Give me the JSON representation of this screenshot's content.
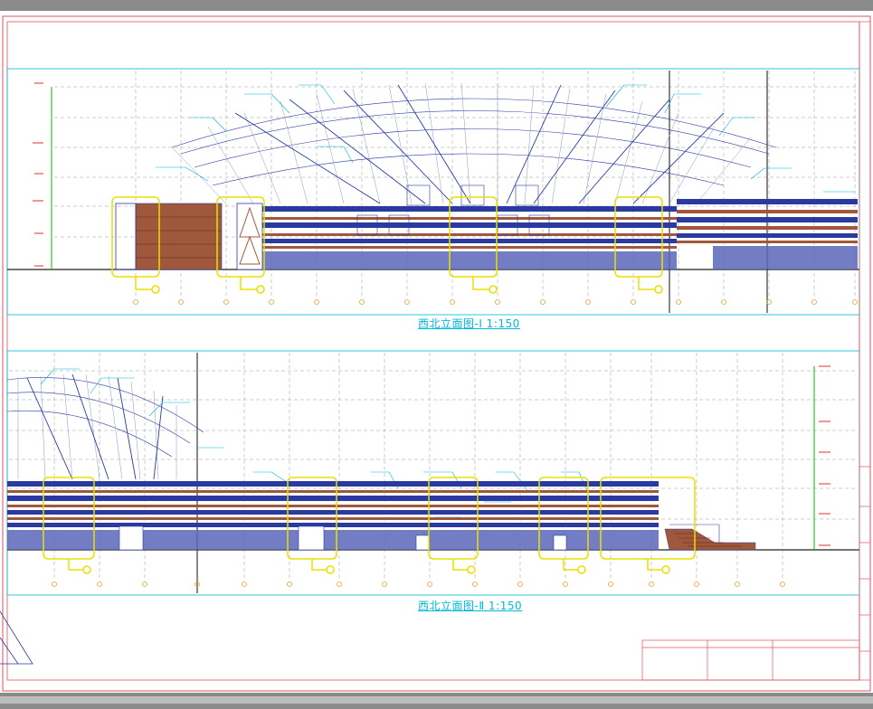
{
  "drawing": {
    "elevation_1_title": "西北立面图-Ⅰ  1:150",
    "elevation_2_title": "西北立面图-Ⅱ  1:150"
  },
  "colors": {
    "frame": "#e05060",
    "grid": "#9a9a9a",
    "structure": "#2a3aa0",
    "brick": "#a0583c",
    "cyan": "#00b8d8",
    "callout": "#e8e000",
    "dim": "#00c000",
    "axis_bubble": "#e8a030"
  },
  "title_block": {
    "cells": [
      "",
      "",
      ""
    ]
  }
}
